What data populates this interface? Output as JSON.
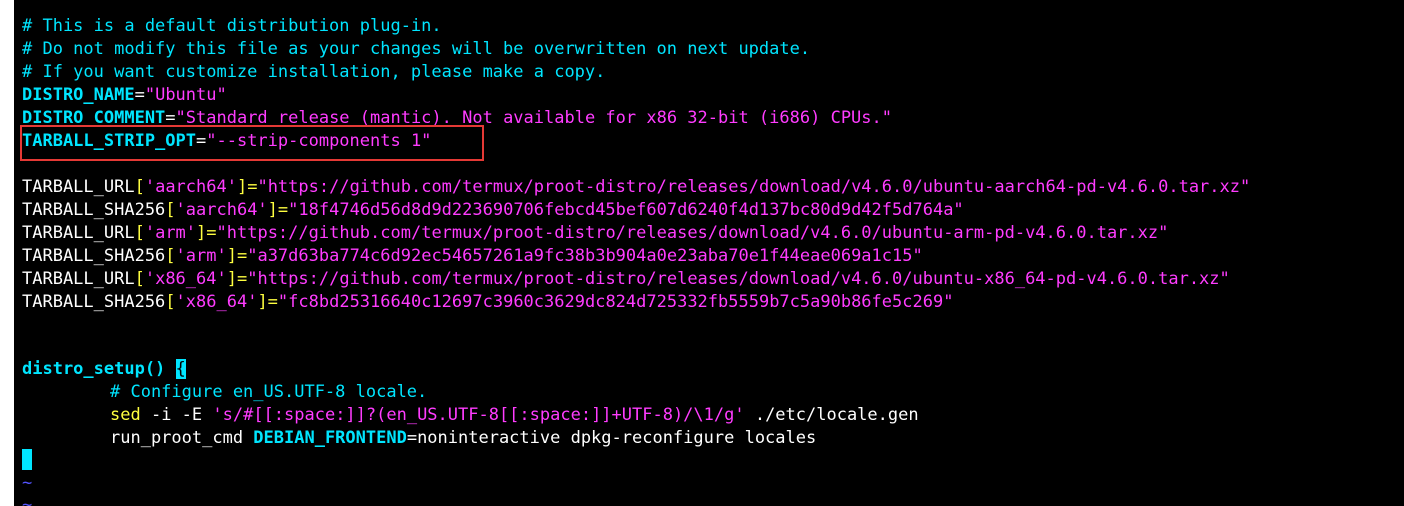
{
  "editor": {
    "top_fragment": "",
    "comments": [
      "# This is a default distribution plug-in.",
      "# Do not modify this file as your changes will be overwritten on next update.",
      "# If you want customize installation, please make a copy."
    ],
    "distro_name": {
      "var": "DISTRO_NAME",
      "eq": "=",
      "value": "\"Ubuntu\""
    },
    "distro_comment": {
      "var": "DISTRO_COMMENT",
      "eq": "=",
      "value": "\"Standard release (mantic). Not available for x86 32-bit (i686) CPUs.\""
    },
    "tarball_strip": {
      "var": "TARBALL_STRIP_OPT",
      "eq": "=",
      "value": "\"--strip-components 1\""
    },
    "tarballs": [
      {
        "name": "TARBALL_URL",
        "ob": "[",
        "key": "'aarch64'",
        "cb": "]=",
        "value": "\"https://github.com/termux/proot-distro/releases/download/v4.6.0/ubuntu-aarch64-pd-v4.6.0.tar.xz\""
      },
      {
        "name": "TARBALL_SHA256",
        "ob": "[",
        "key": "'aarch64'",
        "cb": "]=",
        "value": "\"18f4746d56d8d9d223690706febcd45bef607d6240f4d137bc80d9d42f5d764a\""
      },
      {
        "name": "TARBALL_URL",
        "ob": "[",
        "key": "'arm'",
        "cb": "]=",
        "value": "\"https://github.com/termux/proot-distro/releases/download/v4.6.0/ubuntu-arm-pd-v4.6.0.tar.xz\""
      },
      {
        "name": "TARBALL_SHA256",
        "ob": "[",
        "key": "'arm'",
        "cb": "]=",
        "value": "\"a37d63ba774c6d92ec54657261a9fc38b3b904a0e23aba70e1f44eae069a1c15\""
      },
      {
        "name": "TARBALL_URL",
        "ob": "[",
        "key": "'x86_64'",
        "cb": "]=",
        "value": "\"https://github.com/termux/proot-distro/releases/download/v4.6.0/ubuntu-x86_64-pd-v4.6.0.tar.xz\""
      },
      {
        "name": "TARBALL_SHA256",
        "ob": "[",
        "key": "'x86_64'",
        "cb": "]=",
        "value": "\"fc8bd25316640c12697c3960c3629dc824d725332fb5559b7c5a90b86fe5c269\""
      }
    ],
    "func": {
      "name": "distro_setup()",
      "space": " ",
      "brace": "{",
      "comment": "# Configure en_US.UTF-8 locale.",
      "sed_cmd": "sed",
      "sed_flags": " -i -E ",
      "sed_expr": "'s/#[[:space:]]?(en_US.UTF-8[[:space:]]+UTF-8)/\\1/g'",
      "sed_file": " ./etc/locale.gen",
      "run_cmd": "run_proot_cmd ",
      "env_var": "DEBIAN_FRONTEND",
      "env_rest": "=noninteractive dpkg-reconfigure locales"
    },
    "tilde": "~",
    "colors": {
      "background": "#000000",
      "comment": "#00e5ff",
      "string": "#ff3cff",
      "key_quote": "#ffff40",
      "highlight_box": "#e53935"
    }
  }
}
